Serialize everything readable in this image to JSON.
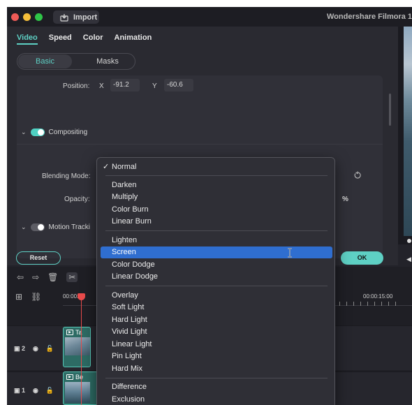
{
  "titlebar": {
    "import_label": "Import",
    "app_title": "Wondershare Filmora 1"
  },
  "tabs": [
    "Video",
    "Speed",
    "Color",
    "Animation"
  ],
  "subtabs": {
    "basic": "Basic",
    "masks": "Masks"
  },
  "position": {
    "label": "Position:",
    "x_label": "X",
    "x_value": "-91.2",
    "y_label": "Y",
    "y_value": "-60.6"
  },
  "compositing": {
    "title": "Compositing",
    "enabled": true,
    "blending_label": "Blending Mode:",
    "opacity_label": "Opacity:",
    "opacity_unit": "%"
  },
  "motion_tracking": {
    "title": "Motion Tracki",
    "enabled": false
  },
  "buttons": {
    "reset": "Reset",
    "ok": "OK"
  },
  "timeline": {
    "time_start": "00:00:00",
    "time_mark": "00:00:15:00",
    "track2_label": "2",
    "track1_label": "1",
    "clip2_label": "Ta",
    "clip1_label": "Be"
  },
  "blend_menu": {
    "checked_item": "Normal",
    "groups": [
      [
        "Darken",
        "Multiply",
        "Color Burn",
        "Linear Burn"
      ],
      [
        "Lighten",
        "Screen",
        "Color Dodge",
        "Linear Dodge"
      ],
      [
        "Overlay",
        "Soft Light",
        "Hard Light",
        "Vivid Light",
        "Linear Light",
        "Pin Light",
        "Hard Mix"
      ],
      [
        "Difference",
        "Exclusion"
      ]
    ],
    "highlighted_item": "Screen"
  },
  "colors": {
    "accent": "#5ed0c4",
    "highlight": "#2f6ed0",
    "playhead": "#e94b4b"
  }
}
